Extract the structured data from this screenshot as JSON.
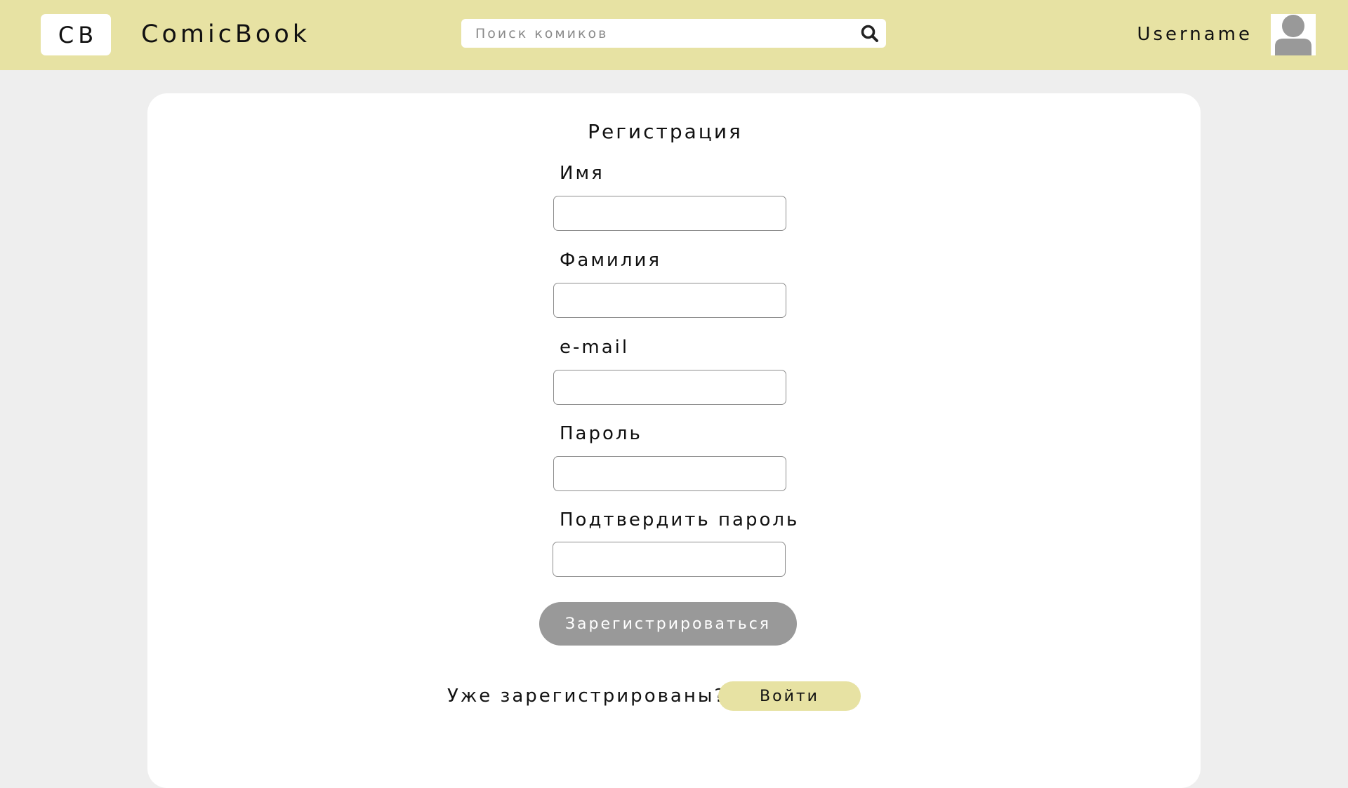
{
  "header": {
    "logo": "CB",
    "brand": "ComicBook",
    "search_placeholder": "Поиск комиков",
    "search_icon": "search-icon",
    "username": "Username",
    "avatar_icon": "user-avatar-icon"
  },
  "form": {
    "title": "Регистрация",
    "fields": [
      {
        "label": "Имя",
        "value": ""
      },
      {
        "label": "Фамилия",
        "value": ""
      },
      {
        "label": "e-mail",
        "value": ""
      },
      {
        "label": "Пароль",
        "value": ""
      },
      {
        "label": "Подтвердить пароль",
        "value": ""
      }
    ],
    "submit_label": "Зарегистрироваться",
    "already_text": "Уже зарегистрированы?",
    "login_label": "Войти"
  },
  "colors": {
    "header_bg": "#e7e2a3",
    "page_bg": "#eeeeee",
    "submit_bg": "#999999",
    "login_bg": "#e7e2a3"
  }
}
